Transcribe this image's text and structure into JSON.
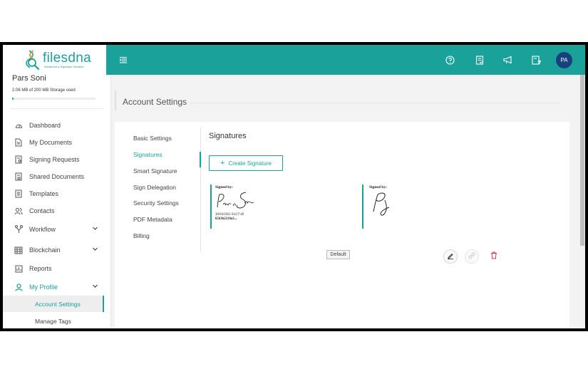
{
  "brand": {
    "name": "filesdna",
    "tagline": "Advanced e-Signature Solution",
    "accent": "#1aa19a",
    "avatar_bg": "#17417a"
  },
  "user": {
    "name": "Pars Soni",
    "storage_text": "2.06 MB of 200 MB Storage used",
    "storage_used_fraction": 0.0103,
    "initials": "PA"
  },
  "sidebar": {
    "items": [
      {
        "label": "Dashboard",
        "icon": "dashboard-icon"
      },
      {
        "label": "My Documents",
        "icon": "document-icon"
      },
      {
        "label": "Signing Requests",
        "icon": "signing-request-icon"
      },
      {
        "label": "Shared Documents",
        "icon": "shared-documents-icon"
      },
      {
        "label": "Templates",
        "icon": "templates-icon"
      },
      {
        "label": "Contacts",
        "icon": "contacts-icon"
      },
      {
        "label": "Workflow",
        "icon": "workflow-icon",
        "expandable": true
      },
      {
        "label": "Blockchain",
        "icon": "blockchain-icon",
        "expandable": true
      },
      {
        "label": "Reports",
        "icon": "reports-icon"
      },
      {
        "label": "My Profile",
        "icon": "profile-icon",
        "expandable": true,
        "expanded": true
      }
    ],
    "subitems": [
      {
        "label": "Account Settings",
        "active": true
      },
      {
        "label": "Manage Tags",
        "active": false
      }
    ]
  },
  "topbar": {
    "menu_icon": "menu-toggle-icon",
    "icons": [
      "help-icon",
      "receipt-icon",
      "announcement-icon",
      "upload-document-icon"
    ]
  },
  "page": {
    "title": "Account Settings"
  },
  "settings_nav": {
    "items": [
      {
        "label": "Basic Settings",
        "active": false
      },
      {
        "label": "Signatures",
        "active": true
      },
      {
        "label": "Smart Signature",
        "active": false
      },
      {
        "label": "Sign Delegation",
        "active": false
      },
      {
        "label": "Security Settings",
        "active": false
      },
      {
        "label": "PDF Metadata",
        "active": false
      },
      {
        "label": "Billing",
        "active": false
      }
    ]
  },
  "signatures": {
    "title": "Signatures",
    "create_label": "Create Signature",
    "list": [
      {
        "signed_by_label": "Signed by:",
        "timestamp": "30/04/2021 04:27:46",
        "hash": "6563b2218a3...",
        "is_default": true,
        "default_label": "Default"
      },
      {
        "signed_by_label": "Signed by:",
        "is_default": false
      }
    ],
    "actions": [
      "edit-icon",
      "link-icon",
      "delete-icon"
    ]
  }
}
